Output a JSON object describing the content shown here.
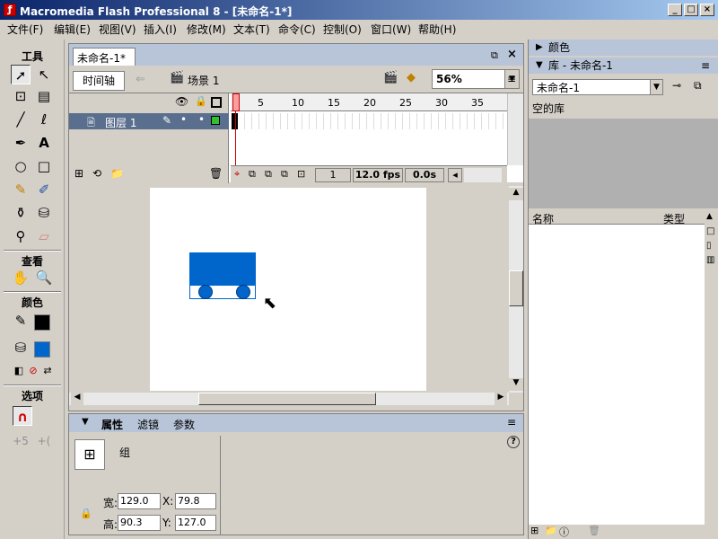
{
  "app": {
    "title": "Macromedia Flash Professional 8 - [未命名-1*]"
  },
  "menu": [
    "文件(F)",
    "编辑(E)",
    "视图(V)",
    "插入(I)",
    "修改(M)",
    "文本(T)",
    "命令(C)",
    "控制(O)",
    "窗口(W)",
    "帮助(H)"
  ],
  "tools": {
    "title": "工具",
    "view_title": "查看",
    "color_title": "颜色",
    "options_title": "选项"
  },
  "document": {
    "tab": "未命名-1*",
    "timeline_button": "时间轴",
    "scene": "场景 1",
    "zoom": "56%"
  },
  "timeline": {
    "layer_name": "图层 1",
    "frame_numbers": [
      "1",
      "5",
      "10",
      "15",
      "20",
      "25",
      "30",
      "35"
    ],
    "current_frame": "1",
    "fps": "12.0 fps",
    "elapsed": "0.0s"
  },
  "properties": {
    "tabs": [
      "属性",
      "滤镜",
      "参数"
    ],
    "object_type": "组",
    "width_label": "宽:",
    "width": "129.0",
    "height_label": "高:",
    "height": "90.3",
    "x_label": "X:",
    "x": "79.8",
    "y_label": "Y:",
    "y": "127.0"
  },
  "panels": {
    "color_title": "颜色",
    "library_title": "库 - 未命名-1",
    "library_select": "未命名-1",
    "library_empty": "空的库",
    "col_name": "名称",
    "col_type": "类型"
  },
  "colors": {
    "shape_fill": "#0066cc",
    "layer_highlight": "#5a6e8e"
  }
}
